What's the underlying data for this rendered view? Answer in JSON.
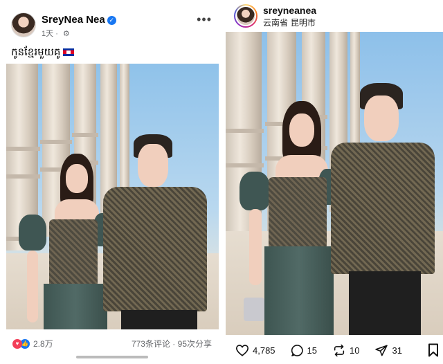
{
  "left_post": {
    "author": "SreyNea Nea",
    "time": "1天",
    "caption": "កូនខ្មែរមួយគូ",
    "reactions_count": "2.8万",
    "stats": "773条评论 · 95次分享"
  },
  "right_post": {
    "username": "sreyneanea",
    "location": "云南省 昆明市",
    "likes": "4,785",
    "comments": "15",
    "reposts": "10",
    "shares": "31"
  },
  "icons": {
    "verified": "verified-badge-icon",
    "privacy": "gear-icon",
    "more": "more-options-icon",
    "flag": "cambodia-flag-icon",
    "like": "heart-icon",
    "comment": "comment-bubble-icon",
    "repost": "repost-icon",
    "share": "send-icon",
    "save": "bookmark-icon"
  },
  "colors": {
    "fb_blue": "#1877f2",
    "love_red": "#f33e58",
    "meta_gray": "#65676b"
  }
}
